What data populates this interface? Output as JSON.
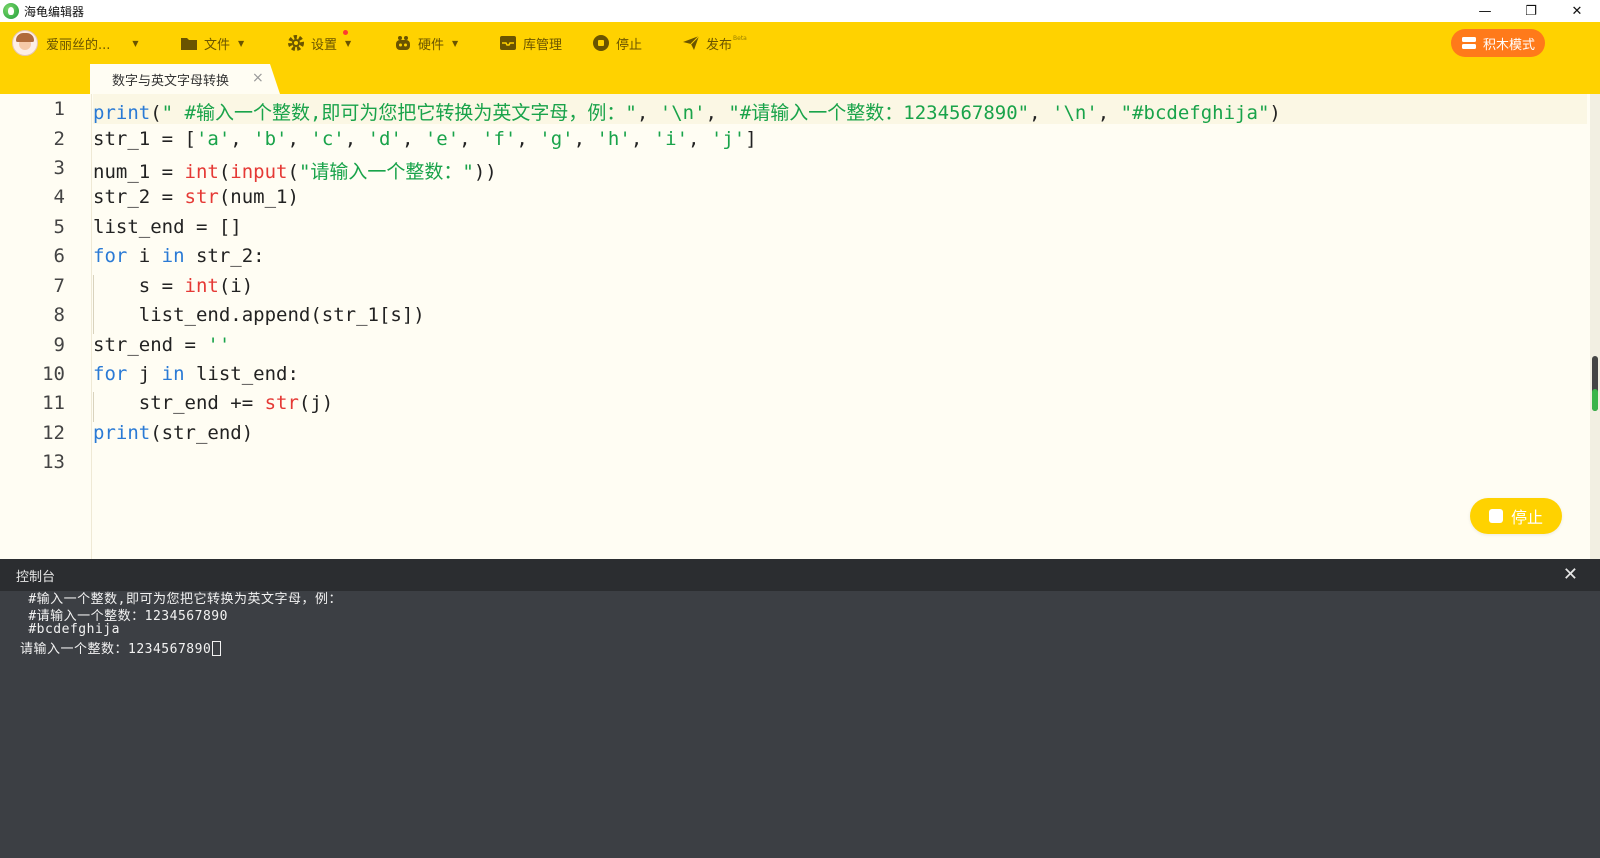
{
  "window": {
    "title": "海龟编辑器",
    "minimize": "—",
    "restore": "❐",
    "close": "✕"
  },
  "toolbar": {
    "user": "爱丽丝的...",
    "file": "文件",
    "settings": "设置",
    "hardware": "硬件",
    "library": "库管理",
    "stop": "停止",
    "publish": "发布",
    "publish_badge": "Beta",
    "block_mode": "积木模式",
    "accent": "#ffd200",
    "block_mode_color": "#ff7a1a"
  },
  "tab": {
    "label": "数字与英文字母转换",
    "close": "×"
  },
  "editor": {
    "line_numbers": [
      "1",
      "2",
      "3",
      "4",
      "5",
      "6",
      "7",
      "8",
      "9",
      "10",
      "11",
      "12",
      "13"
    ],
    "l1": {
      "a": "print",
      "b": "(",
      "c": "\" #输入一个整数,即可为您把它转换为英文字母，例：\"",
      "d": ", ",
      "e": "'\\n'",
      "f": ", ",
      "g": "\"#请输入一个整数：1234567890\"",
      "h": ", ",
      "i": "'\\n'",
      "j": ", ",
      "k": "\"#bcdefghija\"",
      "l": ")"
    },
    "l2": {
      "a": "str_1 = [",
      "b": "'a'",
      "c": ", ",
      "d": "'b'",
      "e": ", ",
      "f": "'c'",
      "g": ", ",
      "h": "'d'",
      "i": ", ",
      "j": "'e'",
      "k": ", ",
      "l": "'f'",
      "m": ", ",
      "n": "'g'",
      "o": ", ",
      "p": "'h'",
      "q": ", ",
      "r": "'i'",
      "s": ", ",
      "t": "'j'",
      "u": "]"
    },
    "l3": {
      "a": "num_1 = ",
      "b": "int",
      "c": "(",
      "d": "input",
      "e": "(",
      "f": "\"请输入一个整数：\"",
      "g": "))"
    },
    "l4": {
      "a": "str_2 = ",
      "b": "str",
      "c": "(num_1)"
    },
    "l5": {
      "a": "list_end = []"
    },
    "l6": {
      "a": "for",
      "b": " i ",
      "c": "in",
      "d": " str_2:"
    },
    "l7": {
      "a": "    s = ",
      "b": "int",
      "c": "(i)"
    },
    "l8": {
      "a": "    list_end.append(str_1[s])"
    },
    "l9": {
      "a": "str_end = ",
      "b": "''"
    },
    "l10": {
      "a": "for",
      "b": " j ",
      "c": "in",
      "d": " list_end:"
    },
    "l11": {
      "a": "    str_end += ",
      "b": "str",
      "c": "(j)"
    },
    "l12": {
      "a": "print",
      "b": "(str_end)"
    },
    "stop_button": "停止"
  },
  "console": {
    "title": "控制台",
    "close": "✕",
    "lines": [
      " #输入一个整数,即可为您把它转换为英文字母，例：",
      " #请输入一个整数：1234567890",
      " #bcdefghija",
      "请输入一个整数：1234567890"
    ]
  }
}
